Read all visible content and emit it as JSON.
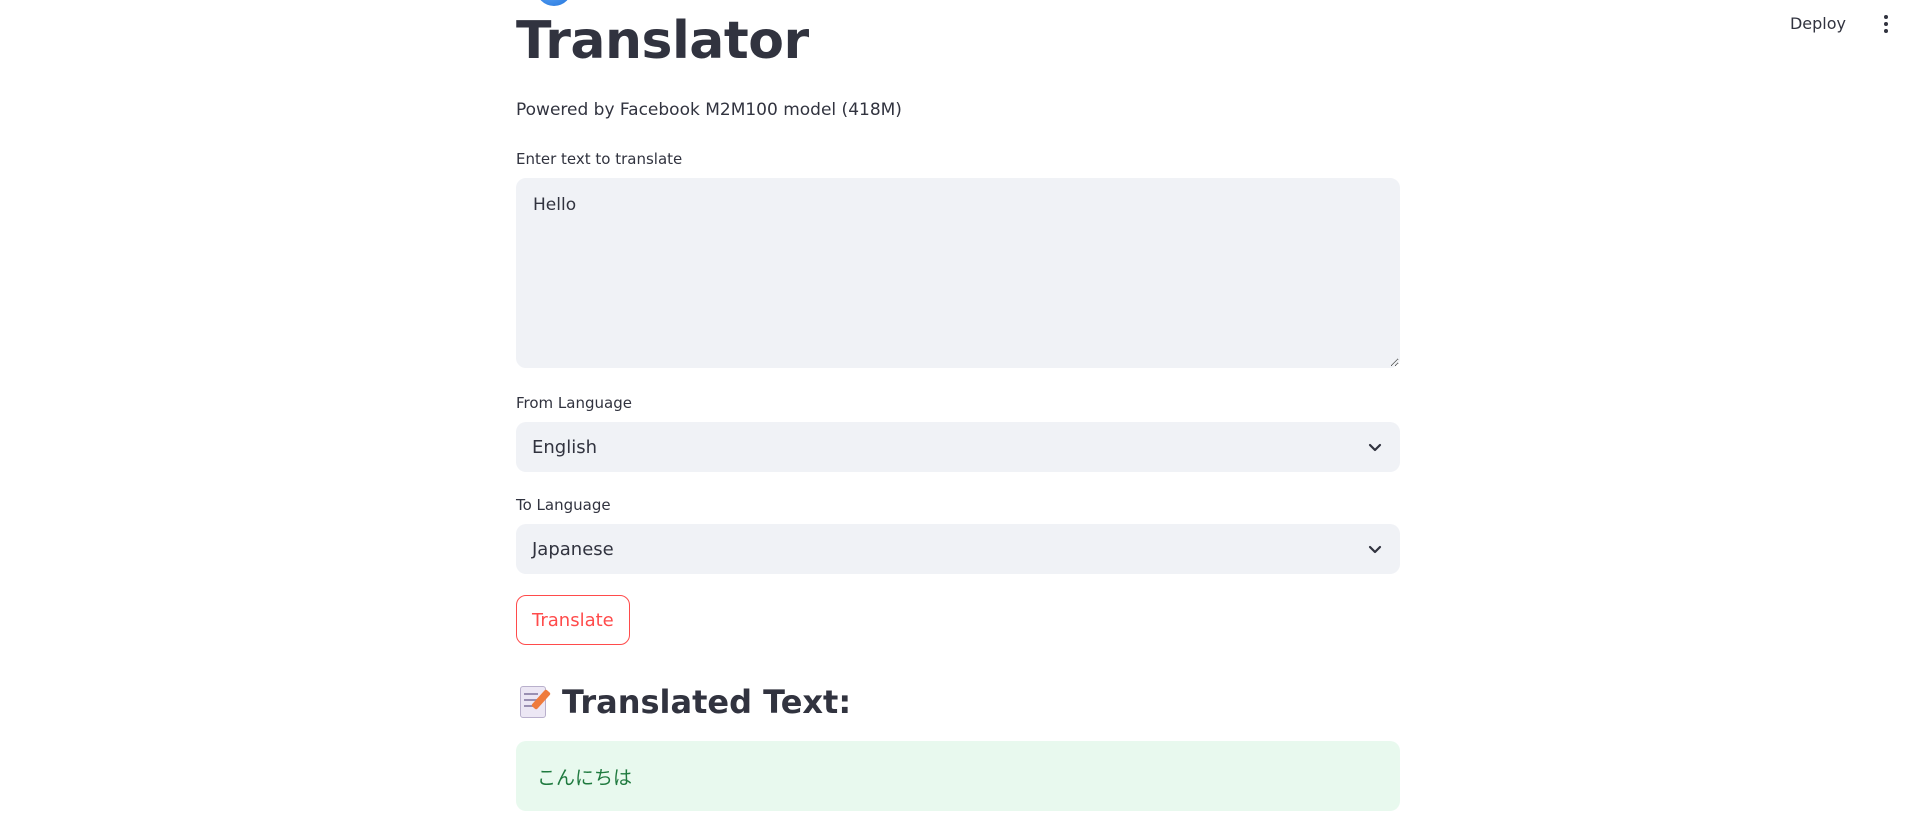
{
  "header": {
    "deploy_label": "Deploy",
    "menu_icon": "more-vertical-icon"
  },
  "main": {
    "title": "Translator",
    "subtitle": "Powered by Facebook M2M100 model (418M)",
    "input": {
      "label": "Enter text to translate",
      "value": "Hello"
    },
    "from_language": {
      "label": "From Language",
      "value": "English"
    },
    "to_language": {
      "label": "To Language",
      "value": "Japanese"
    },
    "translate_label": "Translate",
    "result": {
      "heading": "Translated Text:",
      "icon": "memo-icon",
      "value": "こんにちは"
    }
  },
  "colors": {
    "accent": "#ff4b4b",
    "text": "#31333f",
    "input_bg": "#f0f2f6",
    "success_bg": "#e8f9ee",
    "success_text": "#1f7a3f"
  }
}
